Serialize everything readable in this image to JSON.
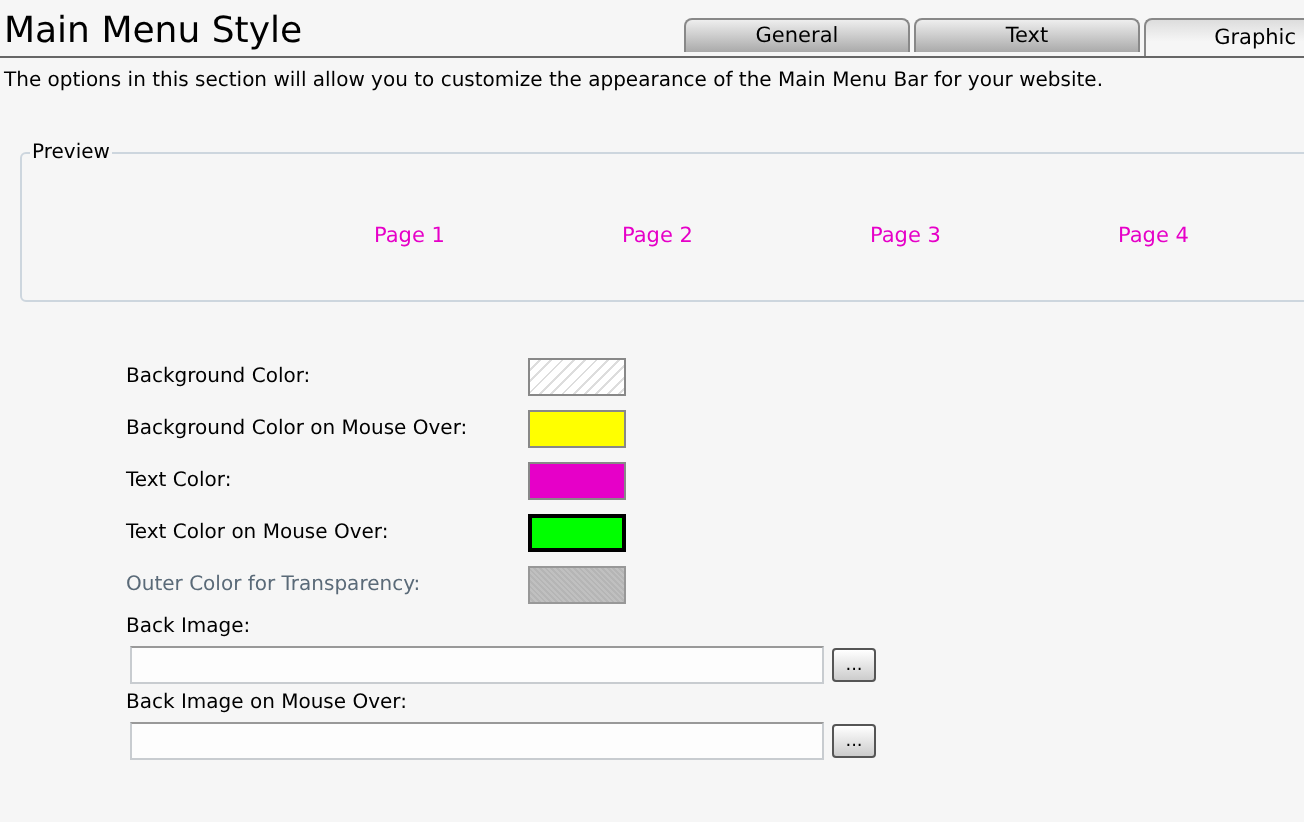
{
  "title": "Main Menu Style",
  "tabs": [
    {
      "label": "General",
      "selected": false
    },
    {
      "label": "Text",
      "selected": false
    },
    {
      "label": "Graphic",
      "selected": true
    }
  ],
  "description": "The options in this section will allow you to customize the appearance of the Main Menu Bar for your website.",
  "preview": {
    "legend": "Preview",
    "items": [
      {
        "label": "Page 1"
      },
      {
        "label": "Page 2"
      },
      {
        "label": "Page 3"
      },
      {
        "label": "Page 4"
      }
    ]
  },
  "color_settings": [
    {
      "label": "Background Color:",
      "kind": "transparent",
      "disabled": false,
      "focused": false
    },
    {
      "label": "Background Color on Mouse Over:",
      "kind": "solid",
      "color": "#ffff00",
      "disabled": false,
      "focused": false
    },
    {
      "label": "Text Color:",
      "kind": "solid",
      "color": "#e600c8",
      "disabled": false,
      "focused": false
    },
    {
      "label": "Text Color on Mouse Over:",
      "kind": "solid",
      "color": "#00ff00",
      "disabled": false,
      "focused": true
    },
    {
      "label": "Outer Color for Transparency:",
      "kind": "solid",
      "color": "#aaaaaa",
      "disabled": true,
      "focused": false
    }
  ],
  "image_settings": [
    {
      "label": "Back Image:",
      "button": "..."
    },
    {
      "label": "Back Image on Mouse Over:",
      "button": "..."
    }
  ]
}
